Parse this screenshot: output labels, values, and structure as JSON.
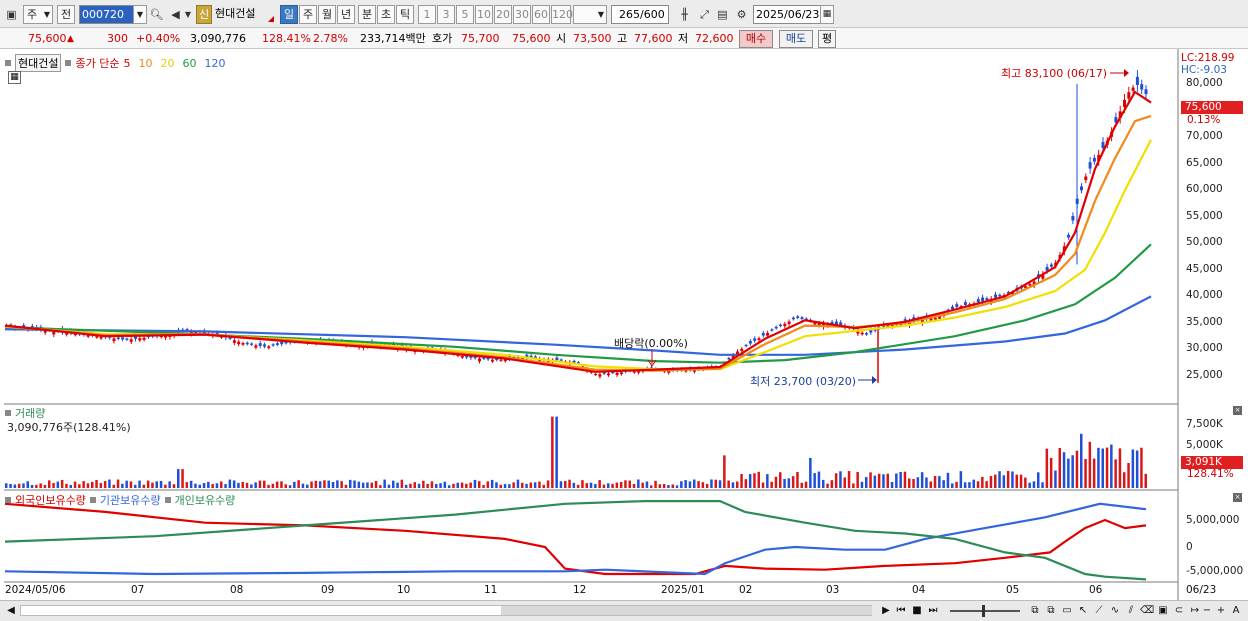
{
  "toolbar": {
    "period_type": "주",
    "prev_btn": "전",
    "stock_code": "000720",
    "stock_badge": "신",
    "stock_name": "현대건설",
    "periods": [
      "일",
      "주",
      "월",
      "년",
      "분",
      "초",
      "틱"
    ],
    "active_period": "일",
    "intervals": [
      "1",
      "3",
      "5",
      "10",
      "20",
      "30",
      "60",
      "120"
    ],
    "count_value": "265",
    "count_total": "/600",
    "date": "2025/06/23"
  },
  "quote": {
    "price": "75,600",
    "change": "300",
    "change_pct": "+0.40%",
    "volume": "3,090,776",
    "volume_ratio": "128.41%",
    "turnover": "2.78%",
    "amount": "233,714백만",
    "ask_label": "호가",
    "ask1": "75,700",
    "ask2": "75,600",
    "open_label": "시",
    "open": "73,500",
    "high_label": "고",
    "high": "77,600",
    "low_label": "저",
    "low": "72,600",
    "buy_btn": "매수",
    "sell_btn": "매도",
    "eval_btn": "평"
  },
  "price_panel": {
    "legend_name": "현대건설",
    "legend_label": "종가 단순",
    "ma_labels": [
      "5",
      "10",
      "20",
      "60",
      "120"
    ],
    "ma_colors": [
      "#e00000",
      "#f08a1a",
      "#f0e000",
      "#229944",
      "#3366dd"
    ],
    "lc": "LC:218.99",
    "hc": "HC:-9.03",
    "current_tag": "75,600",
    "current_pct": "0.13%",
    "y_ticks": [
      "80,000",
      "75,000",
      "70,000",
      "65,000",
      "60,000",
      "55,000",
      "50,000",
      "45,000",
      "40,000",
      "35,000",
      "30,000",
      "25,000"
    ],
    "high_annotation": "최고 83,100 (06/17)",
    "low_annotation": "최저 23,700 (03/20)",
    "dividend_annotation": "배당락(0.00%)"
  },
  "volume_panel": {
    "title": "거래량",
    "value": "3,090,776주(128.41%)",
    "y_ticks": [
      "7,500K",
      "5,000K"
    ],
    "current_tag": "3,091K",
    "current_pct": "128.41%"
  },
  "holdings_panel": {
    "legend": [
      "외국인보유수량",
      "기관보유수량",
      "개인보유수량"
    ],
    "colors": [
      "#e00000",
      "#3366dd",
      "#2e8b57"
    ],
    "y_ticks": [
      "5,000,000",
      "0",
      "-5,000,000"
    ]
  },
  "x_axis": {
    "labels": [
      "2024/05/06",
      "07",
      "08",
      "09",
      "10",
      "11",
      "12",
      "2025/01",
      "02",
      "03",
      "04",
      "05",
      "06",
      "06/23"
    ]
  },
  "chart_data": {
    "type": "line",
    "ylim": [
      22000,
      85000
    ],
    "close_points": [
      [
        0,
        34500
      ],
      [
        30,
        33800
      ],
      [
        60,
        33200
      ],
      [
        90,
        32500
      ],
      [
        120,
        31800
      ],
      [
        150,
        32500
      ],
      [
        180,
        33500
      ],
      [
        210,
        32800
      ],
      [
        240,
        31000
      ],
      [
        260,
        30500
      ],
      [
        290,
        31500
      ],
      [
        320,
        31800
      ],
      [
        350,
        30800
      ],
      [
        380,
        31000
      ],
      [
        410,
        30000
      ],
      [
        440,
        29800
      ],
      [
        460,
        28500
      ],
      [
        490,
        28000
      ],
      [
        520,
        28500
      ],
      [
        550,
        28000
      ],
      [
        570,
        27500
      ],
      [
        590,
        25300
      ],
      [
        610,
        25600
      ],
      [
        640,
        26200
      ],
      [
        670,
        26000
      ],
      [
        700,
        26300
      ],
      [
        715,
        26800
      ],
      [
        730,
        29500
      ],
      [
        760,
        33000
      ],
      [
        790,
        36000
      ],
      [
        810,
        35000
      ],
      [
        840,
        34500
      ],
      [
        860,
        32800
      ],
      [
        880,
        34500
      ],
      [
        910,
        35500
      ],
      [
        930,
        36000
      ],
      [
        950,
        38000
      ],
      [
        970,
        38800
      ],
      [
        990,
        39800
      ],
      [
        1010,
        41000
      ],
      [
        1030,
        43000
      ],
      [
        1050,
        46500
      ],
      [
        1062,
        51000
      ],
      [
        1070,
        57000
      ],
      [
        1080,
        63000
      ],
      [
        1090,
        66000
      ],
      [
        1100,
        69000
      ],
      [
        1110,
        73000
      ],
      [
        1120,
        78000
      ],
      [
        1130,
        80000
      ],
      [
        1140,
        78000
      ],
      [
        1146,
        75600
      ]
    ],
    "ma_points": {
      "5": [
        [
          0,
          34500
        ],
        [
          100,
          32500
        ],
        [
          200,
          32800
        ],
        [
          300,
          31300
        ],
        [
          400,
          30000
        ],
        [
          500,
          28300
        ],
        [
          590,
          25800
        ],
        [
          650,
          26200
        ],
        [
          715,
          26700
        ],
        [
          760,
          32000
        ],
        [
          800,
          35500
        ],
        [
          850,
          34000
        ],
        [
          900,
          35200
        ],
        [
          950,
          37500
        ],
        [
          1000,
          40000
        ],
        [
          1050,
          45500
        ],
        [
          1070,
          52000
        ],
        [
          1090,
          64000
        ],
        [
          1110,
          72000
        ],
        [
          1130,
          78500
        ],
        [
          1146,
          76500
        ]
      ],
      "10": [
        [
          0,
          34400
        ],
        [
          100,
          32700
        ],
        [
          200,
          32900
        ],
        [
          300,
          31500
        ],
        [
          400,
          30200
        ],
        [
          500,
          28500
        ],
        [
          590,
          26200
        ],
        [
          650,
          26000
        ],
        [
          715,
          26400
        ],
        [
          760,
          31000
        ],
        [
          800,
          34500
        ],
        [
          850,
          34200
        ],
        [
          900,
          35000
        ],
        [
          950,
          37000
        ],
        [
          1000,
          39500
        ],
        [
          1050,
          44000
        ],
        [
          1070,
          48000
        ],
        [
          1090,
          58000
        ],
        [
          1110,
          66000
        ],
        [
          1130,
          73000
        ],
        [
          1146,
          74000
        ]
      ],
      "20": [
        [
          0,
          34300
        ],
        [
          100,
          32900
        ],
        [
          200,
          32800
        ],
        [
          300,
          31700
        ],
        [
          400,
          30500
        ],
        [
          500,
          29000
        ],
        [
          590,
          26800
        ],
        [
          650,
          26300
        ],
        [
          715,
          26300
        ],
        [
          760,
          29500
        ],
        [
          800,
          32500
        ],
        [
          850,
          33500
        ],
        [
          900,
          34500
        ],
        [
          950,
          36000
        ],
        [
          1000,
          38000
        ],
        [
          1050,
          41000
        ],
        [
          1080,
          45000
        ],
        [
          1100,
          52000
        ],
        [
          1120,
          60000
        ],
        [
          1146,
          69500
        ]
      ],
      "60": [
        [
          0,
          34200
        ],
        [
          150,
          33200
        ],
        [
          300,
          32000
        ],
        [
          450,
          30500
        ],
        [
          550,
          29000
        ],
        [
          650,
          27800
        ],
        [
          715,
          27500
        ],
        [
          780,
          28000
        ],
        [
          850,
          29500
        ],
        [
          950,
          32500
        ],
        [
          1020,
          35500
        ],
        [
          1070,
          38500
        ],
        [
          1110,
          43500
        ],
        [
          1146,
          49800
        ]
      ],
      "120": [
        [
          0,
          33800
        ],
        [
          200,
          33400
        ],
        [
          400,
          32300
        ],
        [
          550,
          30900
        ],
        [
          650,
          29800
        ],
        [
          715,
          29000
        ],
        [
          800,
          29000
        ],
        [
          900,
          30000
        ],
        [
          1000,
          31500
        ],
        [
          1060,
          33000
        ],
        [
          1100,
          35500
        ],
        [
          1146,
          40000
        ]
      ]
    },
    "volume_ylim": [
      0,
      8500
    ],
    "holdings_ylim": [
      -8000000,
      9000000
    ]
  }
}
